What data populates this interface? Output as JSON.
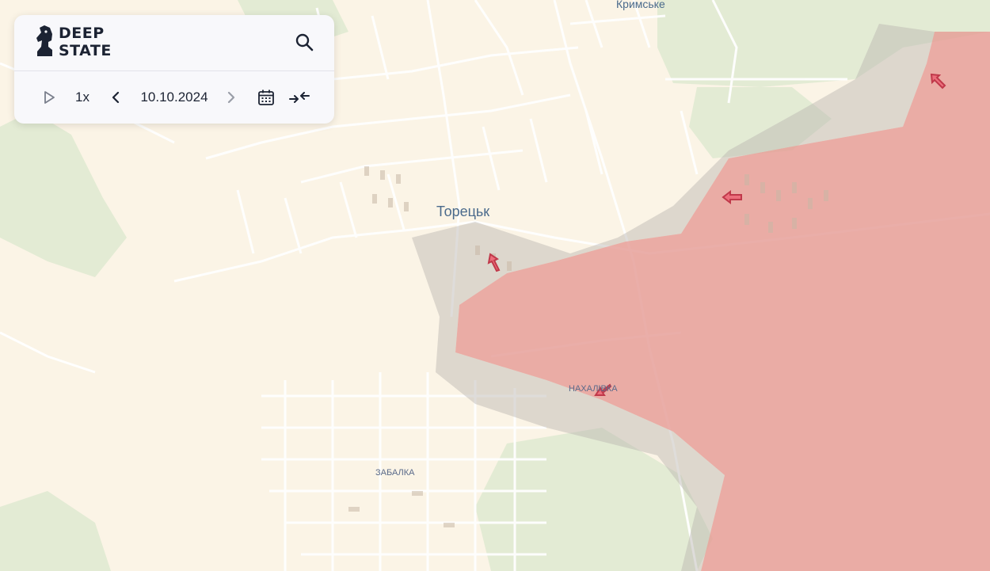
{
  "app": {
    "logo_line1": "DEEP",
    "logo_line2": "STATE"
  },
  "toolbar": {
    "speed": "1x",
    "date": "10.10.2024"
  },
  "icons": {
    "logo": "knight-chess-icon",
    "search": "search-icon",
    "play": "play-icon",
    "prev": "chevron-left-icon",
    "next": "chevron-right-icon",
    "calendar": "calendar-icon",
    "compare": "compare-arrows-icon"
  },
  "map": {
    "labels": {
      "krymske": "Кримське",
      "toretsk": "Торецьк",
      "nakhalivka": "НАХАЛІВКА",
      "zabalka": "ЗАБАЛКА"
    },
    "colors": {
      "land": "#fbf4e6",
      "fields": "#e4ecd5",
      "occupied": "#e59c96",
      "contested": "#c8c4c0",
      "roads": "#ffffff",
      "arrows": "#e05b6a"
    }
  }
}
